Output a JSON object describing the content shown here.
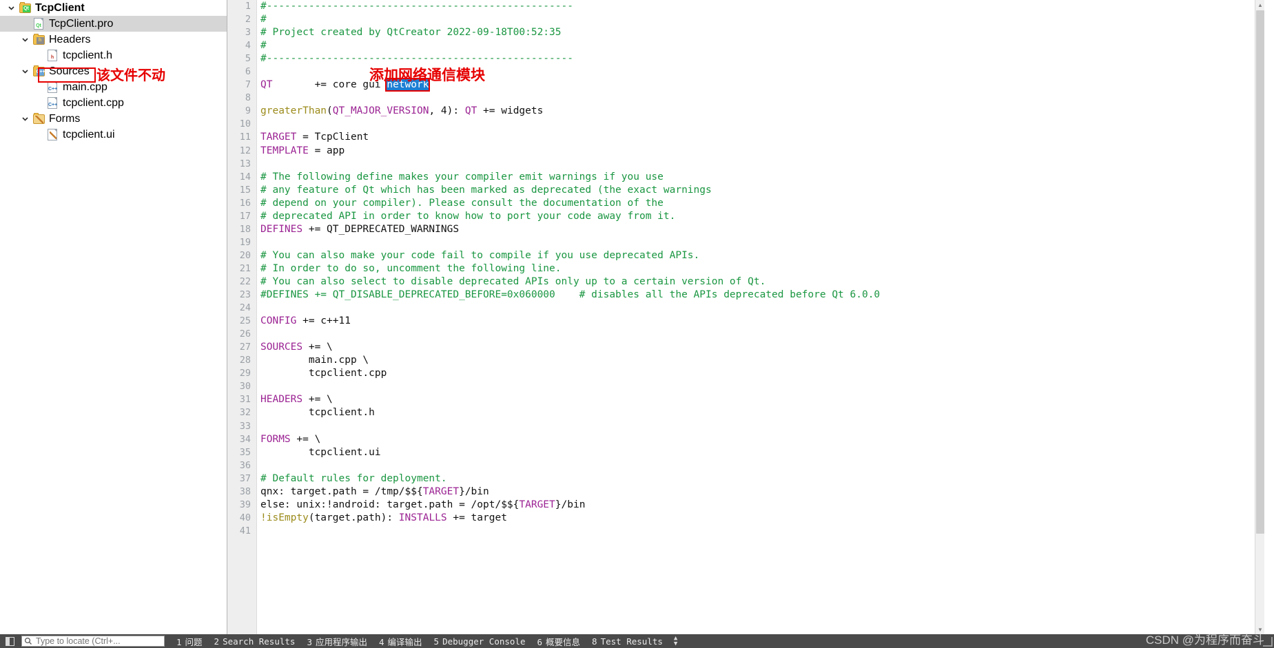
{
  "sidebar": {
    "nodes": [
      {
        "label": "TcpClient",
        "icon": "folder-qt-icon",
        "depth": 0,
        "chevron": "down",
        "bold": true,
        "selected": false
      },
      {
        "label": "TcpClient.pro",
        "icon": "file-qt-icon",
        "depth": 1,
        "chevron": "none",
        "bold": false,
        "selected": true
      },
      {
        "label": "Headers",
        "icon": "folder-h-icon",
        "depth": 1,
        "chevron": "down",
        "bold": false,
        "selected": false
      },
      {
        "label": "tcpclient.h",
        "icon": "file-h-icon",
        "depth": 2,
        "chevron": "none",
        "bold": false,
        "selected": false
      },
      {
        "label": "Sources",
        "icon": "folder-cpp-icon",
        "depth": 1,
        "chevron": "down",
        "bold": false,
        "selected": false
      },
      {
        "label": "main.cpp",
        "icon": "file-cpp-icon",
        "depth": 2,
        "chevron": "none",
        "bold": false,
        "selected": false
      },
      {
        "label": "tcpclient.cpp",
        "icon": "file-cpp-icon",
        "depth": 2,
        "chevron": "none",
        "bold": false,
        "selected": false
      },
      {
        "label": "Forms",
        "icon": "folder-forms-icon",
        "depth": 1,
        "chevron": "down",
        "bold": false,
        "selected": false
      },
      {
        "label": "tcpclient.ui",
        "icon": "file-ui-icon",
        "depth": 2,
        "chevron": "none",
        "bold": false,
        "selected": false
      }
    ]
  },
  "annotations": {
    "sidebar_note": "该文件不动",
    "editor_note": "添加网络通信模块",
    "box_color": "#e60000"
  },
  "editor": {
    "selection_text": "network",
    "selection_bg": "#1d7fd4",
    "lines": [
      {
        "n": 1,
        "parts": [
          {
            "t": "#---------------------------------------------------",
            "c": "cmt"
          }
        ]
      },
      {
        "n": 2,
        "parts": [
          {
            "t": "#",
            "c": "cmt"
          }
        ]
      },
      {
        "n": 3,
        "parts": [
          {
            "t": "# Project created by QtCreator 2022-09-18T00:52:35",
            "c": "cmt"
          }
        ]
      },
      {
        "n": 4,
        "parts": [
          {
            "t": "#",
            "c": "cmt"
          }
        ]
      },
      {
        "n": 5,
        "parts": [
          {
            "t": "#---------------------------------------------------",
            "c": "cmt"
          }
        ]
      },
      {
        "n": 6,
        "parts": []
      },
      {
        "n": 7,
        "parts": [
          {
            "t": "QT",
            "c": "kw"
          },
          {
            "t": "       += core gui ",
            "c": "pln"
          },
          {
            "t": "network",
            "c": "sel"
          }
        ]
      },
      {
        "n": 8,
        "parts": []
      },
      {
        "n": 9,
        "parts": [
          {
            "t": "greaterThan",
            "c": "fn"
          },
          {
            "t": "(",
            "c": "pln"
          },
          {
            "t": "QT_MAJOR_VERSION",
            "c": "kw"
          },
          {
            "t": ", 4): ",
            "c": "pln"
          },
          {
            "t": "QT",
            "c": "kw"
          },
          {
            "t": " += widgets",
            "c": "pln"
          }
        ]
      },
      {
        "n": 10,
        "parts": []
      },
      {
        "n": 11,
        "parts": [
          {
            "t": "TARGET",
            "c": "kw"
          },
          {
            "t": " = TcpClient",
            "c": "pln"
          }
        ]
      },
      {
        "n": 12,
        "parts": [
          {
            "t": "TEMPLATE",
            "c": "kw"
          },
          {
            "t": " = app",
            "c": "pln"
          }
        ]
      },
      {
        "n": 13,
        "parts": []
      },
      {
        "n": 14,
        "parts": [
          {
            "t": "# The following define makes your compiler emit warnings if you use",
            "c": "cmt"
          }
        ]
      },
      {
        "n": 15,
        "parts": [
          {
            "t": "# any feature of Qt which has been marked as deprecated (the exact warnings",
            "c": "cmt"
          }
        ]
      },
      {
        "n": 16,
        "parts": [
          {
            "t": "# depend on your compiler). Please consult the documentation of the",
            "c": "cmt"
          }
        ]
      },
      {
        "n": 17,
        "parts": [
          {
            "t": "# deprecated API in order to know how to port your code away from it.",
            "c": "cmt"
          }
        ]
      },
      {
        "n": 18,
        "parts": [
          {
            "t": "DEFINES",
            "c": "kw"
          },
          {
            "t": " += QT_DEPRECATED_WARNINGS",
            "c": "pln"
          }
        ]
      },
      {
        "n": 19,
        "parts": []
      },
      {
        "n": 20,
        "parts": [
          {
            "t": "# You can also make your code fail to compile if you use deprecated APIs.",
            "c": "cmt"
          }
        ]
      },
      {
        "n": 21,
        "parts": [
          {
            "t": "# In order to do so, uncomment the following line.",
            "c": "cmt"
          }
        ]
      },
      {
        "n": 22,
        "parts": [
          {
            "t": "# You can also select to disable deprecated APIs only up to a certain version of Qt.",
            "c": "cmt"
          }
        ]
      },
      {
        "n": 23,
        "parts": [
          {
            "t": "#DEFINES += QT_DISABLE_DEPRECATED_BEFORE=0x060000    # disables all the APIs deprecated before Qt 6.0.0",
            "c": "cmt"
          }
        ]
      },
      {
        "n": 24,
        "parts": []
      },
      {
        "n": 25,
        "parts": [
          {
            "t": "CONFIG",
            "c": "kw"
          },
          {
            "t": " += c++11",
            "c": "pln"
          }
        ]
      },
      {
        "n": 26,
        "parts": []
      },
      {
        "n": 27,
        "parts": [
          {
            "t": "SOURCES",
            "c": "kw"
          },
          {
            "t": " += \\",
            "c": "pln"
          }
        ]
      },
      {
        "n": 28,
        "parts": [
          {
            "t": "        main.cpp \\",
            "c": "pln"
          }
        ]
      },
      {
        "n": 29,
        "parts": [
          {
            "t": "        tcpclient.cpp",
            "c": "pln"
          }
        ]
      },
      {
        "n": 30,
        "parts": []
      },
      {
        "n": 31,
        "parts": [
          {
            "t": "HEADERS",
            "c": "kw"
          },
          {
            "t": " += \\",
            "c": "pln"
          }
        ]
      },
      {
        "n": 32,
        "parts": [
          {
            "t": "        tcpclient.h",
            "c": "pln"
          }
        ]
      },
      {
        "n": 33,
        "parts": []
      },
      {
        "n": 34,
        "parts": [
          {
            "t": "FORMS",
            "c": "kw"
          },
          {
            "t": " += \\",
            "c": "pln"
          }
        ]
      },
      {
        "n": 35,
        "parts": [
          {
            "t": "        tcpclient.ui",
            "c": "pln"
          }
        ]
      },
      {
        "n": 36,
        "parts": []
      },
      {
        "n": 37,
        "parts": [
          {
            "t": "# Default rules for deployment.",
            "c": "cmt"
          }
        ]
      },
      {
        "n": 38,
        "parts": [
          {
            "t": "qnx: target.path = /tmp/$${",
            "c": "pln"
          },
          {
            "t": "TARGET",
            "c": "kw"
          },
          {
            "t": "}/bin",
            "c": "pln"
          }
        ]
      },
      {
        "n": 39,
        "parts": [
          {
            "t": "else: unix:!android: target.path = /opt/$${",
            "c": "pln"
          },
          {
            "t": "TARGET",
            "c": "kw"
          },
          {
            "t": "}/bin",
            "c": "pln"
          }
        ]
      },
      {
        "n": 40,
        "parts": [
          {
            "t": "!isEmpty",
            "c": "fn"
          },
          {
            "t": "(target.path): ",
            "c": "pln"
          },
          {
            "t": "INSTALLS",
            "c": "kw"
          },
          {
            "t": " += target",
            "c": "pln"
          }
        ]
      },
      {
        "n": 41,
        "parts": []
      }
    ]
  },
  "statusbar": {
    "locator_placeholder": "Type to locate (Ctrl+...",
    "locator_value": "",
    "items": [
      {
        "num": "1",
        "label": "问题"
      },
      {
        "num": "2",
        "label": "Search Results"
      },
      {
        "num": "3",
        "label": "应用程序输出"
      },
      {
        "num": "4",
        "label": "编译输出"
      },
      {
        "num": "5",
        "label": "Debugger Console"
      },
      {
        "num": "6",
        "label": "概要信息"
      },
      {
        "num": "8",
        "label": "Test Results"
      }
    ],
    "watermark": "CSDN @为程序而奋斗"
  }
}
